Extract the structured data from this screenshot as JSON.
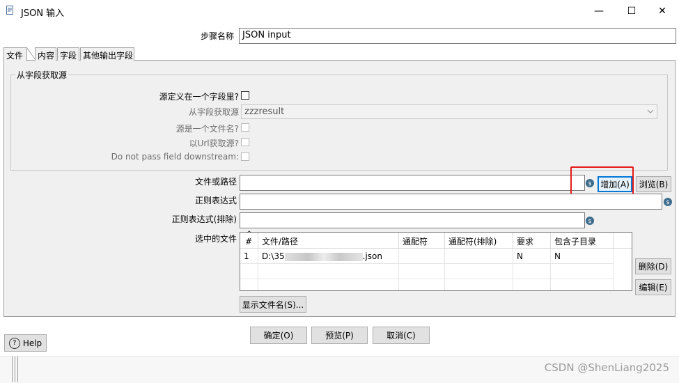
{
  "window": {
    "title": "JSON 输入",
    "minimize_glyph": "—",
    "maximize_glyph": "☐",
    "close_glyph": "✕"
  },
  "step_name": {
    "label": "步骤名称",
    "value": "JSON input"
  },
  "tabs": [
    {
      "label": "文件",
      "active": true
    },
    {
      "label": "内容",
      "active": false
    },
    {
      "label": "字段",
      "active": false
    },
    {
      "label": "其他输出字段",
      "active": false
    }
  ],
  "source_group": {
    "title": "从字段获取源",
    "source_in_field": {
      "label": "源定义在一个字段里?",
      "checked": false
    },
    "get_source_from_field": {
      "label": "从字段获取源",
      "value": "zzzresult"
    },
    "source_is_filename": {
      "label": "源是一个文件名?",
      "checked": false
    },
    "read_source_as_url": {
      "label": "以Url获取源?",
      "checked": false
    },
    "do_not_pass_field": {
      "label": "Do not pass field downstream:",
      "checked": false
    }
  },
  "file_or_dir": {
    "label": "文件或路径",
    "value": ""
  },
  "regex": {
    "label": "正则表达式",
    "value": ""
  },
  "regex_exclude": {
    "label": "正则表达式(排除)",
    "value": ""
  },
  "buttons": {
    "add": "增加(A)",
    "browse": "浏览(B)",
    "delete": "删除(D)",
    "edit": "编辑(E)",
    "show_filenames": "显示文件名(S)...",
    "ok": "确定(O)",
    "preview": "预览(P)",
    "cancel": "取消(C)",
    "help": "Help",
    "var_icon_glyph": "$",
    "help_icon_glyph": "?"
  },
  "selected_files": {
    "label": "选中的文件",
    "sort_glyph": "^",
    "columns": [
      "#",
      "文件/路径",
      "通配符",
      "通配符(排除)",
      "要求",
      "包含子目录"
    ],
    "rows": [
      {
        "num": "1",
        "path_prefix": "D:\\35",
        "path_suffix": ".json",
        "wildcard": "",
        "wildcard_exclude": "",
        "required": "N",
        "include_subfolders": "N"
      }
    ]
  },
  "watermark": "CSDN @ShenLiang2025",
  "colors": {
    "highlight": "#e81818",
    "panel_bg": "#f0f0f0",
    "variable_icon": "#3d6c8c"
  }
}
